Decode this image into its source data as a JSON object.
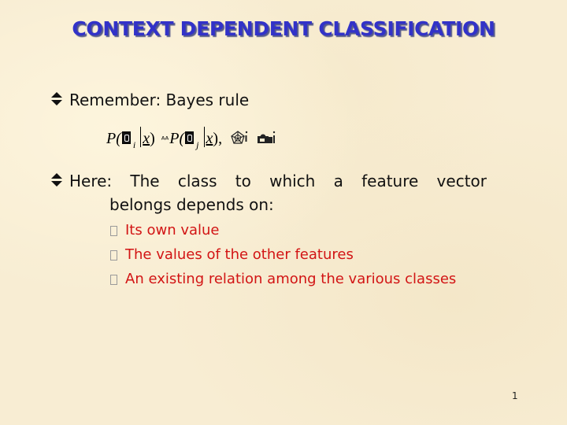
{
  "slide": {
    "title": "CONTEXT DEPENDENT CLASSIFICATION",
    "page_number": "1",
    "colors": {
      "title": "#3232c8",
      "sub_bullets": "#d21414",
      "background": "#f8edd3"
    }
  },
  "bullets": [
    {
      "icon": "up-down-arrow-icon",
      "text": "Remember:  Bayes rule"
    },
    {
      "icon": "up-down-arrow-icon",
      "text_line1": "Here:  The class to which a feature vector",
      "text_line2": "belongs depends on:"
    }
  ],
  "formula": {
    "p1": "P(",
    "sub_i": "i",
    "x1": "x",
    "close1": ")",
    "gt": "ᴬᴬ",
    "p2": "P(",
    "sub_j": "j",
    "x2": "x",
    "close2": "),",
    "symbols": [
      "spider-web-icon",
      "camera-icon"
    ]
  },
  "sub_bullets": [
    "Its own value",
    "The values of the other features",
    "An existing relation among the various classes"
  ]
}
